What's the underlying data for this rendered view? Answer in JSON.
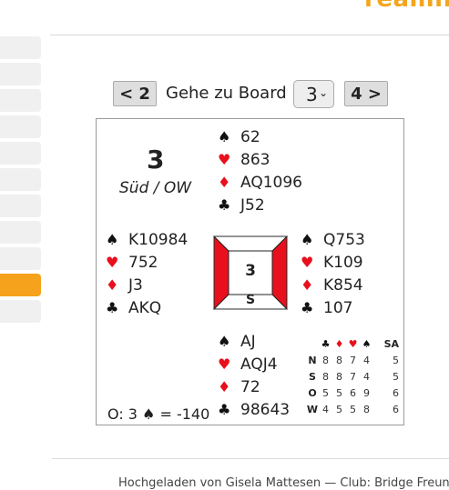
{
  "header": {
    "brand": "reamne"
  },
  "sidebar": {
    "count": 11,
    "active_index": 9
  },
  "nav": {
    "prev_label": "< 2",
    "goto_label": "Gehe zu Board",
    "board_select": "3",
    "next_label": "4 >"
  },
  "board": {
    "number": "3",
    "dealer_vul": "Süd / OW",
    "north": {
      "spades": "62",
      "hearts": "863",
      "diamonds": "AQ1096",
      "clubs": "J52"
    },
    "west": {
      "spades": "K10984",
      "hearts": "752",
      "diamonds": "J3",
      "clubs": "AKQ"
    },
    "east": {
      "spades": "Q753",
      "hearts": "K109",
      "diamonds": "K854",
      "clubs": "107"
    },
    "south": {
      "spades": "AJ",
      "hearts": "AQJ4",
      "diamonds": "72",
      "clubs": "98643"
    },
    "compass": {
      "number": "3",
      "dealer": "S"
    },
    "result": "O: 3 ♠ = -140",
    "dd_table": {
      "headers": [
        "♣",
        "♦",
        "♥",
        "♠",
        "SA"
      ],
      "rows": [
        {
          "label": "N",
          "values": [
            "8",
            "8",
            "7",
            "4",
            "5"
          ]
        },
        {
          "label": "S",
          "values": [
            "8",
            "8",
            "7",
            "4",
            "5"
          ]
        },
        {
          "label": "O",
          "values": [
            "5",
            "5",
            "6",
            "9",
            "6"
          ]
        },
        {
          "label": "W",
          "values": [
            "4",
            "5",
            "5",
            "8",
            "6"
          ]
        }
      ]
    }
  },
  "footer": {
    "text": "Hochgeladen von Gisela Mattesen — Club: Bridge Freun"
  },
  "colors": {
    "accent": "#f6a21c",
    "red_suit": "#e8101d",
    "vul_red": "#e8101d"
  }
}
